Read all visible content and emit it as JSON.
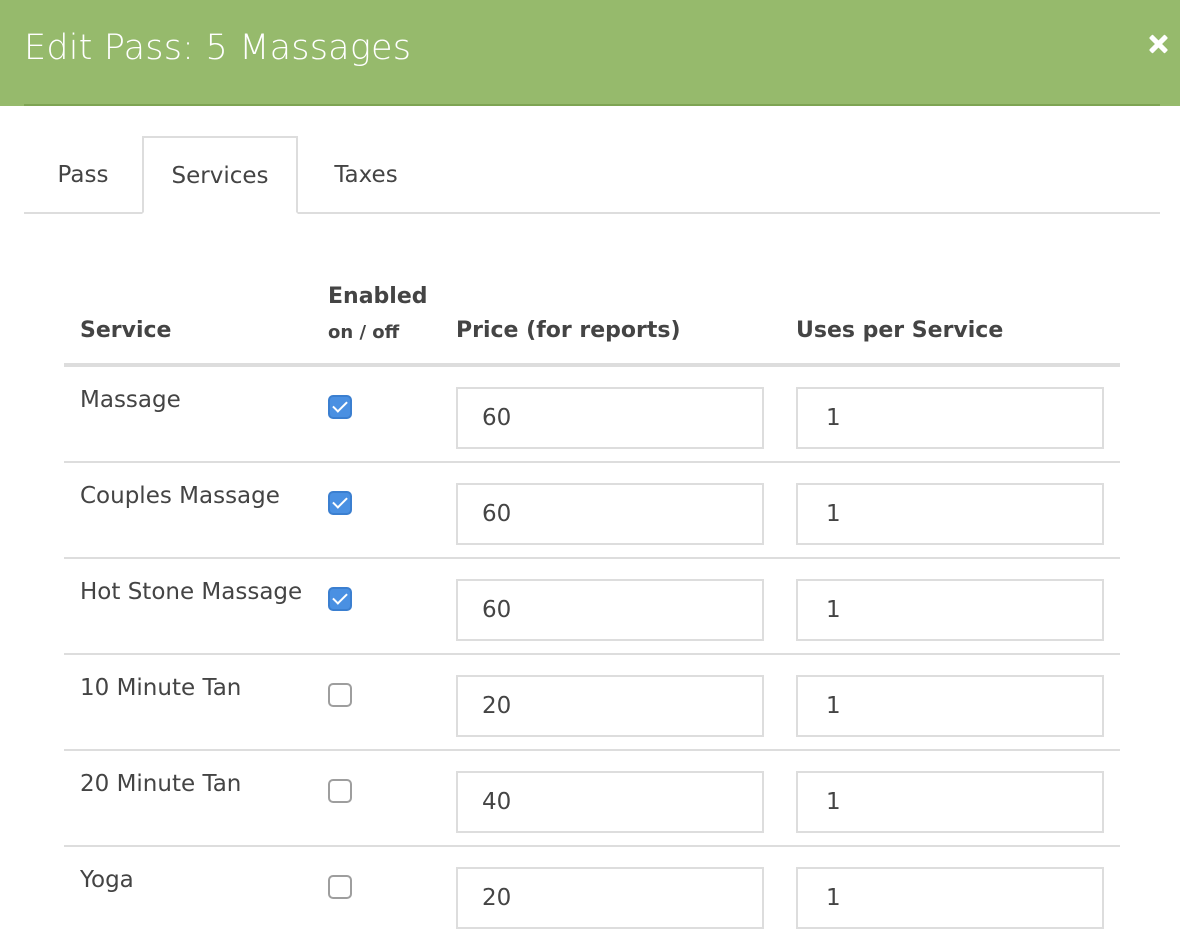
{
  "header": {
    "title": "Edit Pass: 5 Massages",
    "close_icon": "close-icon"
  },
  "tabs": [
    {
      "label": "Pass",
      "active": false
    },
    {
      "label": "Services",
      "active": true
    },
    {
      "label": "Taxes",
      "active": false
    }
  ],
  "table": {
    "columns": {
      "service": "Service",
      "enabled": "Enabled",
      "enabled_sub": "on / off",
      "price": "Price (for reports)",
      "uses": "Uses per Service"
    },
    "rows": [
      {
        "service": "Massage",
        "enabled": true,
        "price": "60",
        "uses": "1"
      },
      {
        "service": "Couples Massage",
        "enabled": true,
        "price": "60",
        "uses": "1"
      },
      {
        "service": "Hot Stone Massage",
        "enabled": true,
        "price": "60",
        "uses": "1"
      },
      {
        "service": "10 Minute Tan",
        "enabled": false,
        "price": "20",
        "uses": "1"
      },
      {
        "service": "20 Minute Tan",
        "enabled": false,
        "price": "40",
        "uses": "1"
      },
      {
        "service": "Yoga",
        "enabled": false,
        "price": "20",
        "uses": "1"
      }
    ]
  },
  "colors": {
    "header_bg": "#96ba6c",
    "checkbox_on": "#4a90e2"
  }
}
